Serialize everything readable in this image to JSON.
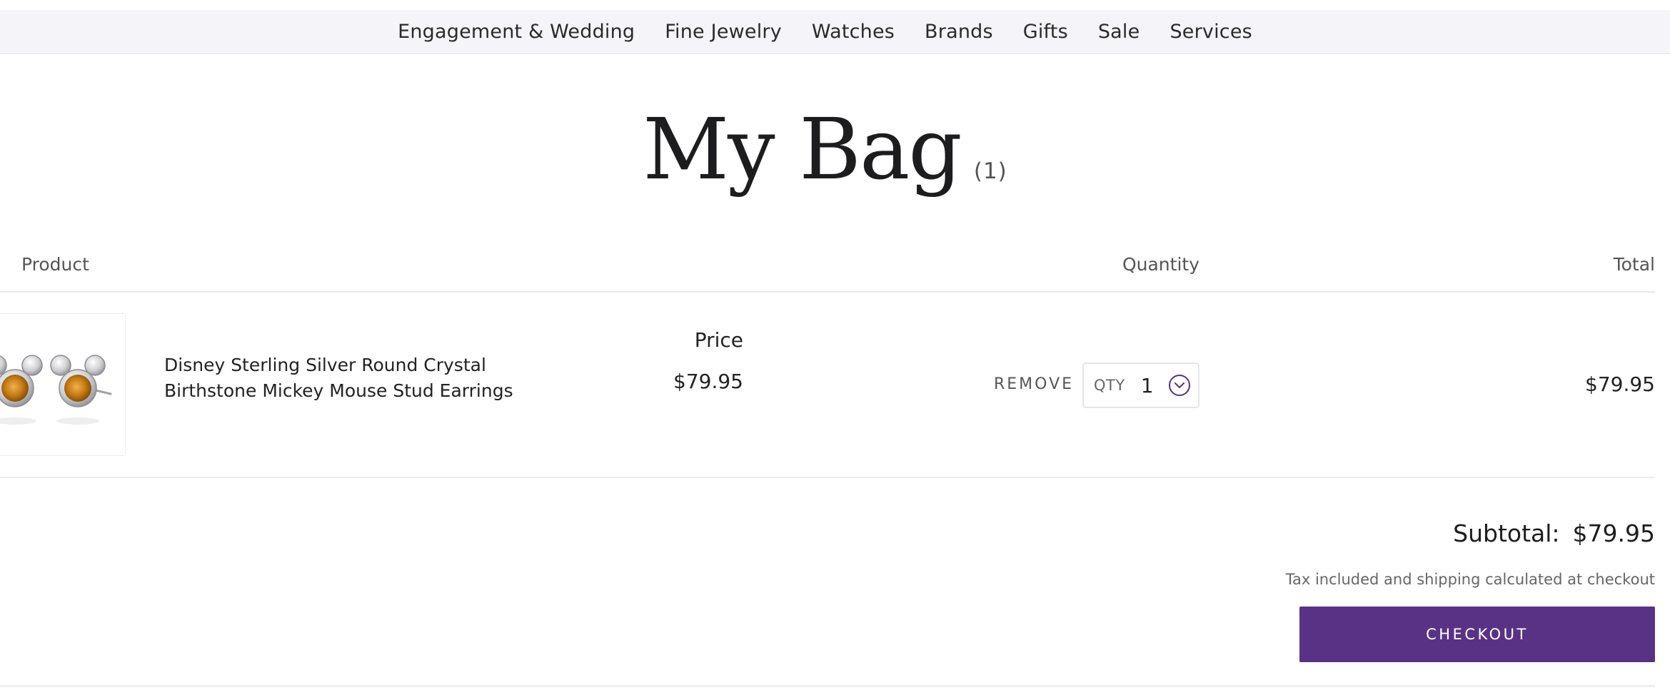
{
  "nav": {
    "items": [
      "Engagement & Wedding",
      "Fine Jewelry",
      "Watches",
      "Brands",
      "Gifts",
      "Sale",
      "Services"
    ]
  },
  "page": {
    "title": "My Bag",
    "count": "(1)"
  },
  "table": {
    "headers": {
      "product": "Product",
      "price": "Price",
      "quantity": "Quantity",
      "total": "Total"
    },
    "rows": [
      {
        "name_line1": "Disney Sterling Silver Round Crystal",
        "name_line2": "Birthstone Mickey Mouse Stud Earrings",
        "price": "$79.95",
        "remove_label": "REMOVE",
        "qty_label": "QTY",
        "qty_value": "1",
        "total": "$79.95"
      }
    ]
  },
  "summary": {
    "subtotal_label": "Subtotal:",
    "subtotal_value": "$79.95",
    "tax_note": "Tax included and shipping calculated at checkout",
    "checkout_label": "CHECKOUT"
  },
  "colors": {
    "brand_purple": "#5a3285",
    "nav_bg": "#f5f4f8"
  },
  "icons": {
    "qty_dropdown": "chevron-down-circle-icon",
    "product_image": "mickey-earrings-thumbnail"
  }
}
